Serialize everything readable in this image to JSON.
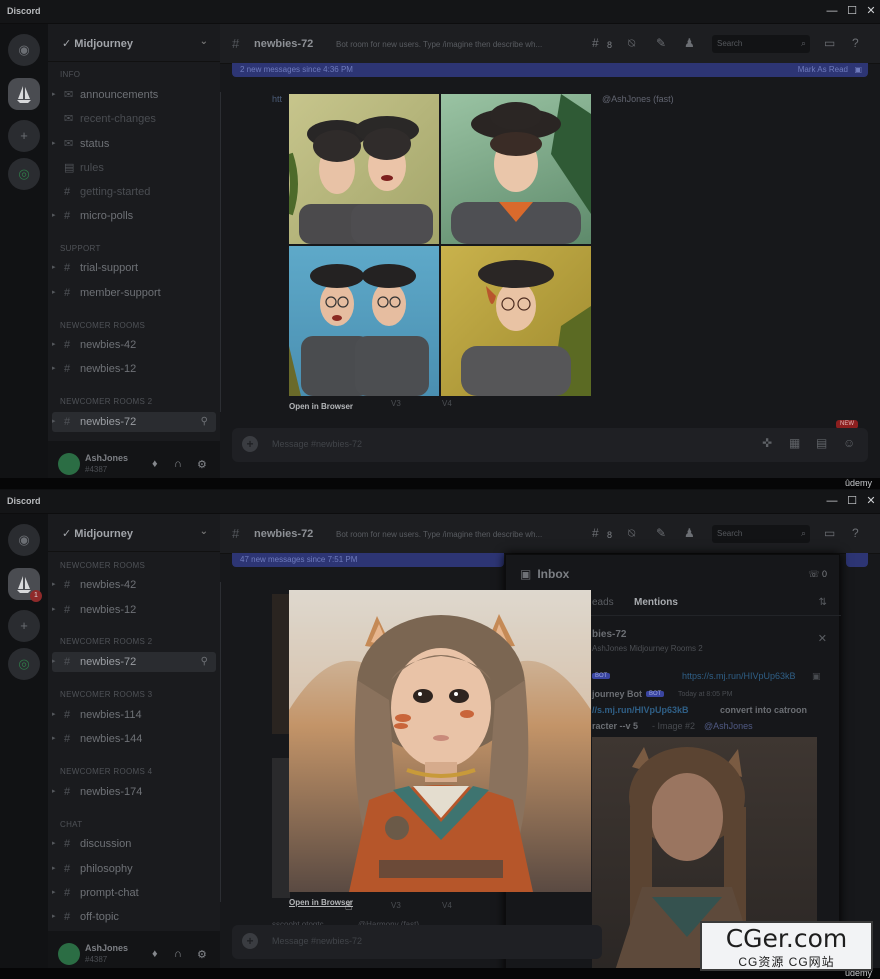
{
  "app": {
    "name": "Discord",
    "watermark_domain": "CGer.com",
    "watermark_sub": "CG资源 CG网站",
    "udemy": "ûdemy"
  },
  "server": {
    "name": "Midjourney"
  },
  "user": {
    "name": "AshJones",
    "tag": "#4387"
  },
  "channel": {
    "name": "newbies-72",
    "topic": "Bot room for new users. Type /imagine then describe wh...",
    "thread_count": "8",
    "search_placeholder": "Search",
    "composer_placeholder": "Message #newbies-72",
    "new_tag": "NEW"
  },
  "frame1": {
    "categories": [
      {
        "label": "INFO"
      },
      {
        "label": "SUPPORT"
      },
      {
        "label": "NEWCOMER ROOMS"
      },
      {
        "label": "NEWCOMER ROOMS 2"
      }
    ],
    "channels": [
      {
        "name": "announcements"
      },
      {
        "name": "recent-changes"
      },
      {
        "name": "status"
      },
      {
        "name": "rules"
      },
      {
        "name": "getting-started"
      },
      {
        "name": "micro-polls"
      },
      {
        "name": "trial-support"
      },
      {
        "name": "member-support"
      },
      {
        "name": "newbies-42"
      },
      {
        "name": "newbies-12"
      },
      {
        "name": "newbies-72"
      }
    ],
    "newbar_text": "2 new messages since 4:36 PM",
    "mark_as_read": "Mark As Read",
    "mention_text": "@AshJones (fast)",
    "link_fragment": "htt",
    "open_in_browser": "Open in Browser",
    "v3": "V3",
    "v4": "V4"
  },
  "frame2": {
    "categories": [
      {
        "label": "NEWCOMER ROOMS"
      },
      {
        "label": "NEWCOMER ROOMS 2"
      },
      {
        "label": "NEWCOMER ROOMS 3"
      },
      {
        "label": "NEWCOMER ROOMS 4"
      },
      {
        "label": "CHAT"
      }
    ],
    "channels": [
      {
        "name": "newbies-42"
      },
      {
        "name": "newbies-12"
      },
      {
        "name": "newbies-72"
      },
      {
        "name": "newbies-114"
      },
      {
        "name": "newbies-144"
      },
      {
        "name": "newbies-174"
      },
      {
        "name": "discussion"
      },
      {
        "name": "philosophy"
      },
      {
        "name": "prompt-chat"
      },
      {
        "name": "off-topic"
      }
    ],
    "server_badge": "1",
    "newbar_text": "47 new messages since 7:51 PM",
    "open_in_browser": "Open in Browser",
    "v3": "V3",
    "v4": "V4",
    "footer_frag": "sscoobt otogtc",
    "footer_mention": "@Harmony (fast)",
    "inbox": {
      "title": "Inbox",
      "count": "0",
      "tab_partial": "eads",
      "tab_mentions": "Mentions",
      "channel": "bies-72",
      "channel_sub": "AshJones Midjourney Rooms 2",
      "bot_tag": "BOT",
      "link1": "https://s.mj.run/HIVpUp63kB",
      "bot_name": "journey Bot",
      "time": "Today at 8:05 PM",
      "link2": "//s.mj.run/HIVpUp63kB",
      "prompt": "convert into catroon",
      "prompt2": "racter --v 5",
      "image_label": "- Image #2",
      "mention": "@AshJones"
    }
  },
  "colors": {
    "accent": "#5865f2",
    "bg": "#17181b",
    "sidebar": "#1a1b1e"
  }
}
